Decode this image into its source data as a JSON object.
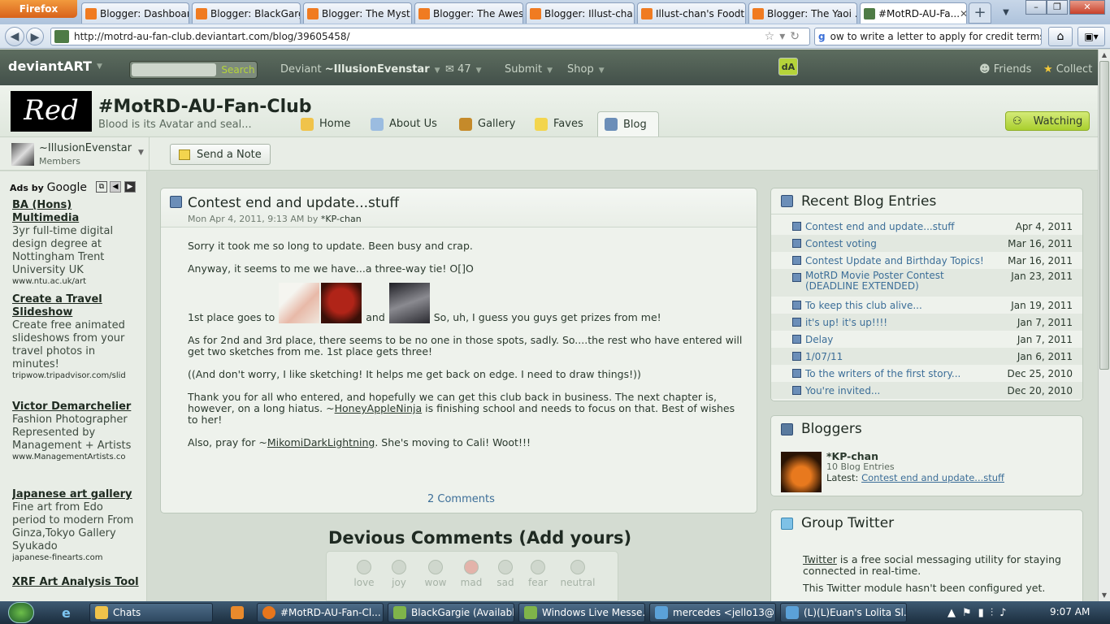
{
  "browser": {
    "app_button": "Firefox",
    "tabs": [
      {
        "label": "Blogger: Dashboard",
        "icon": "blogger-icon"
      },
      {
        "label": "Blogger: BlackGarg...",
        "icon": "blogger-icon"
      },
      {
        "label": "Blogger: The Myst...",
        "icon": "blogger-icon"
      },
      {
        "label": "Blogger: The Awes...",
        "icon": "blogger-icon"
      },
      {
        "label": "Blogger: Illust-cha...",
        "icon": "blogger-icon"
      },
      {
        "label": "Illust-chan's Foodt...",
        "icon": "blogger-icon"
      },
      {
        "label": "Blogger: The Yaoi ...",
        "icon": "blogger-icon"
      },
      {
        "label": "#MotRD-AU-Fa...",
        "icon": "deviantart-icon",
        "active": true
      }
    ],
    "url": "http://motrd-au-fan-club.deviantart.com/blog/39605458/",
    "search_text": "ow to write a letter to apply for credit terms"
  },
  "da_nav": {
    "logo": "deviantART",
    "search_button": "Search",
    "deviant_label": "Deviant",
    "deviant_name": "~IllusionEvenstar",
    "messages_count": "47",
    "submit": "Submit",
    "shop": "Shop",
    "friends": "Friends",
    "collect": "Collect"
  },
  "group": {
    "avatar_text": "Red",
    "title": "#MotRD-AU-Fan-Club",
    "tagline": "Blood is its Avatar and seal...",
    "tabs": [
      "Home",
      "About Us",
      "Gallery",
      "Faves",
      "Blog"
    ],
    "watching": "Watching",
    "member_name": "~IllusionEvenstar",
    "member_role": "Members",
    "send_note": "Send a Note"
  },
  "ads": {
    "header": "Ads by",
    "header_brand": "Google",
    "items": [
      {
        "title": "BA (Hons) Multimedia",
        "desc": "3yr full-time digital design degree at Nottingham Trent University UK",
        "url": "www.ntu.ac.uk/art"
      },
      {
        "title": "Create a Travel Slideshow",
        "desc": "Create free animated slideshows from your travel photos in minutes!",
        "url": "tripwow.tripadvisor.com/slid"
      },
      {
        "title": "Victor Demarchelier",
        "desc": "Fashion Photographer Represented by Management + Artists",
        "url": "www.ManagementArtists.co"
      },
      {
        "title": "Japanese art gallery",
        "desc": "Fine art from Edo period to modern From Ginza,Tokyo Gallery Syukado",
        "url": "japanese-finearts.com"
      },
      {
        "title": "XRF Art Analysis Tool",
        "desc": "",
        "url": ""
      }
    ]
  },
  "post": {
    "title": "Contest end and update...stuff",
    "date": "Mon Apr 4, 2011, 9:13 AM by",
    "author": "*KP-chan",
    "p1": "Sorry it took me so long to update. Been busy and crap.",
    "p2": "Anyway, it seems to me we have...a three-way tie! O[]O",
    "p3a": "1st place goes to",
    "p3b": "and",
    "p3c": "So, uh, I guess you guys get prizes from me!",
    "p4": "As for 2nd and 3rd place, there seems to be no one in those spots, sadly. So....the rest who have entered will get two sketches from me. 1st place gets three!",
    "p5": "((And don't worry, I like sketching! It helps me get back on edge. I need to draw things!))",
    "p6a": "Thank you for all who entered, and hopefully we can get this club back in business. The next chapter is, however, on a long hiatus. ~",
    "p6link": "HoneyAppleNinja",
    "p6b": " is finishing school and needs to focus on that. Best of wishes to her!",
    "p7a": "Also, pray for ~",
    "p7link": "MikomiDarkLightning",
    "p7b": ". She's moving to Cali! Woot!!!",
    "comments": "2 Comments"
  },
  "devious": {
    "title": "Devious Comments (Add yours)",
    "moods": [
      "love",
      "joy",
      "wow",
      "mad",
      "sad",
      "fear",
      "neutral"
    ]
  },
  "recent": {
    "title": "Recent Blog Entries",
    "entries": [
      {
        "t": "Contest end and update...stuff",
        "d": "Apr 4, 2011"
      },
      {
        "t": "Contest voting",
        "d": "Mar 16, 2011"
      },
      {
        "t": "Contest Update and Birthday Topics!",
        "d": "Mar 16, 2011"
      },
      {
        "t": "MotRD Movie Poster Contest (DEADLINE EXTENDED)",
        "d": "Jan 23, 2011"
      },
      {
        "t": "To keep this club alive...",
        "d": "Jan 19, 2011"
      },
      {
        "t": "it's up! it's up!!!!",
        "d": "Jan 7, 2011"
      },
      {
        "t": "Delay",
        "d": "Jan 7, 2011"
      },
      {
        "t": "1/07/11",
        "d": "Jan 6, 2011"
      },
      {
        "t": "To the writers of the first story...",
        "d": "Dec 25, 2010"
      },
      {
        "t": "You're invited...",
        "d": "Dec 20, 2010"
      }
    ]
  },
  "bloggers": {
    "title": "Bloggers",
    "name": "*KP-chan",
    "count": "10 Blog Entries",
    "latest_label": "Latest:",
    "latest": "Contest end and update...stuff"
  },
  "twitter": {
    "title": "Group Twitter",
    "link": "Twitter",
    "text1": " is a free social messaging utility for staying connected in real-time.",
    "text2": "This Twitter module hasn't been configured yet."
  },
  "taskbar": {
    "items": [
      "Chats",
      "#MotRD-AU-Fan-Cl...",
      "BlackGargie (Availabl...",
      "Windows Live Messe...",
      "mercedes <jello13@...",
      "(L)(L)Euan's Lolita Sl..."
    ],
    "clock": "9:07 AM"
  }
}
